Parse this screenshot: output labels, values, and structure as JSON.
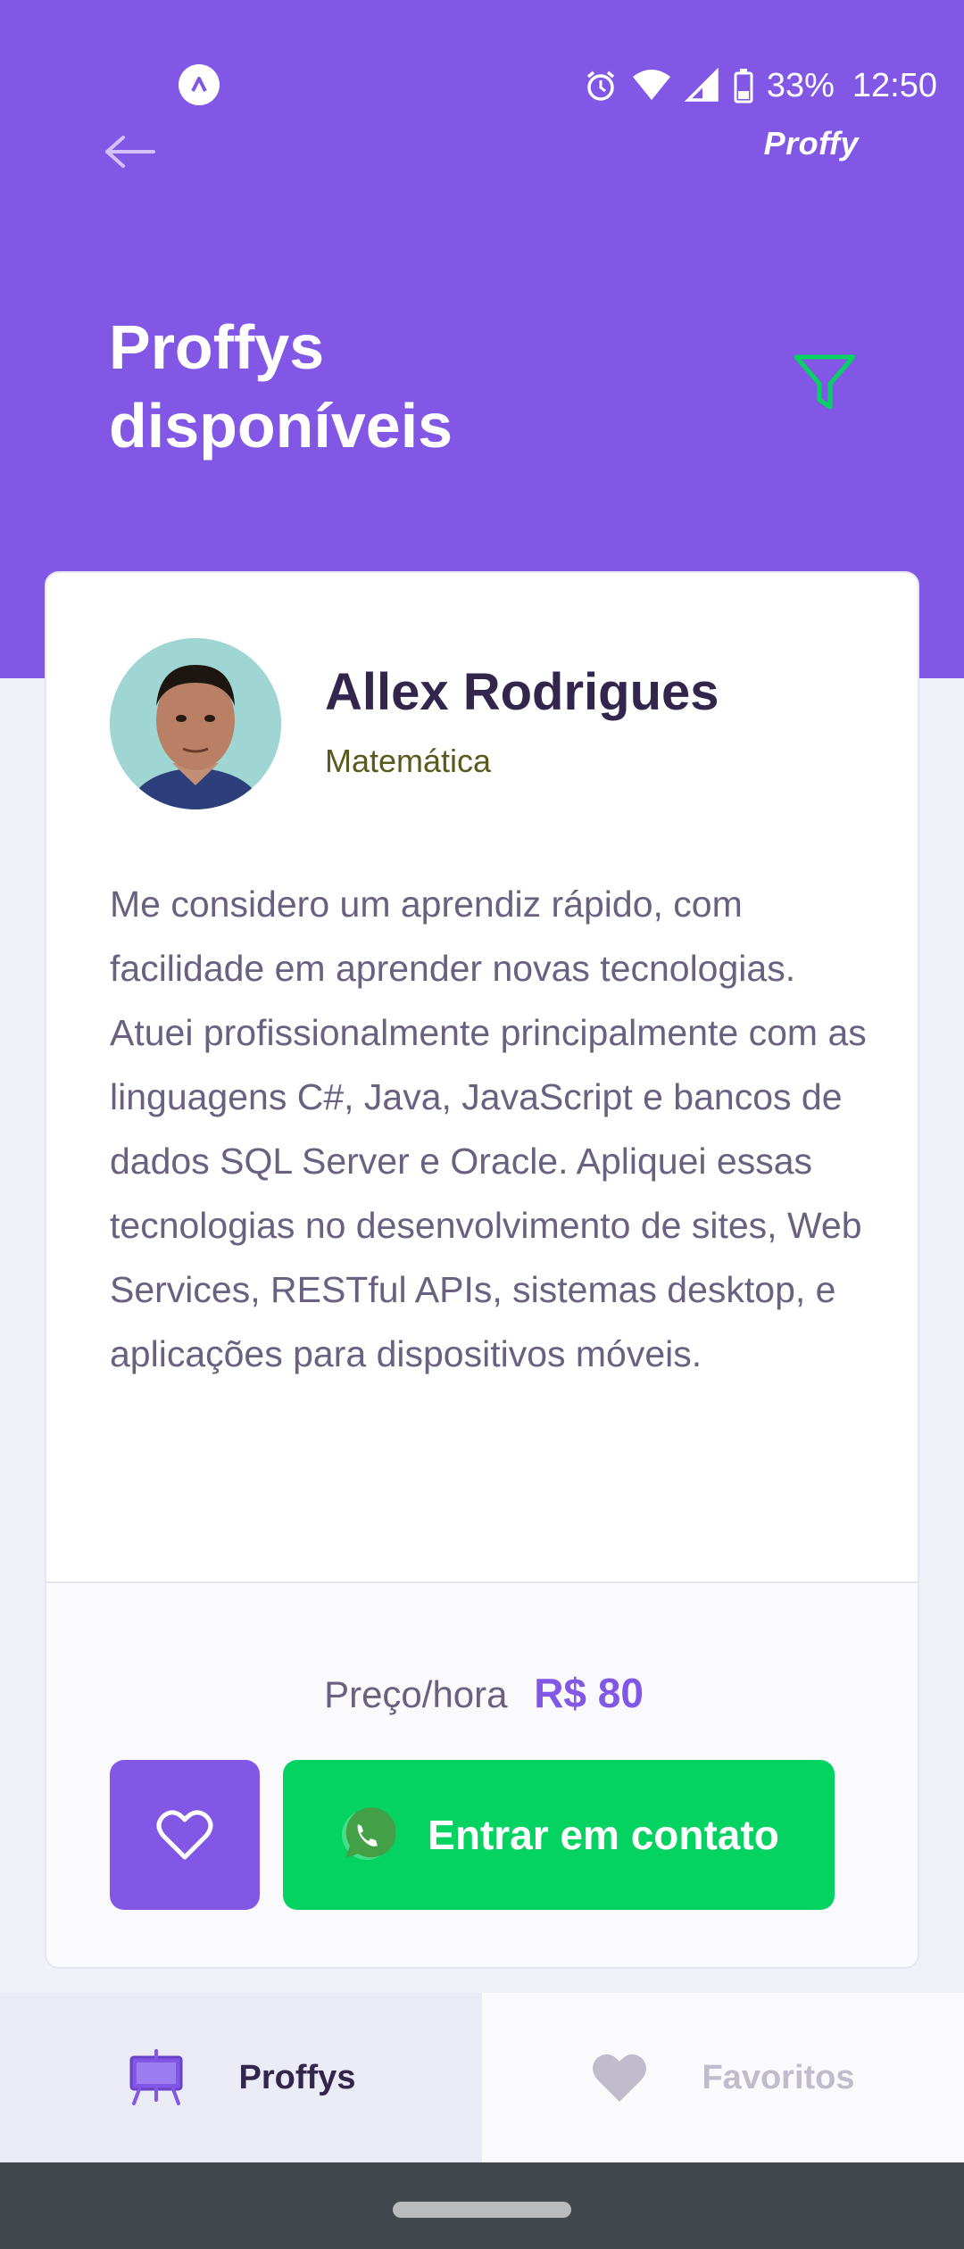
{
  "status_bar": {
    "battery": "33%",
    "time": "12:50"
  },
  "header": {
    "brand": "Proffy",
    "title": "Proffys disponíveis"
  },
  "teacher": {
    "name": "Allex Rodrigues",
    "subject": "Matemática",
    "bio": "Me considero um aprendiz rápido, com facilidade em aprender novas tecnologias. Atuei profissionalmente principalmente com as linguagens C#, Java, JavaScript e bancos de dados SQL Server e Oracle. Apliquei essas tecnologias no desenvolvimento de sites, Web Services, RESTful APIs, sistemas desktop, e aplicações para dispositivos móveis.",
    "price_label": "Preço/hora",
    "price_value": "R$ 80",
    "contact_label": "Entrar em contato"
  },
  "tabs": [
    {
      "label": "Proffys",
      "icon": "easel-icon",
      "active": true
    },
    {
      "label": "Favoritos",
      "icon": "heart-icon",
      "active": false
    }
  ],
  "colors": {
    "primary": "#8257e5",
    "secondary": "#04d361",
    "background": "#f0f0f7",
    "title": "#32264d",
    "text": "#6a6180"
  }
}
